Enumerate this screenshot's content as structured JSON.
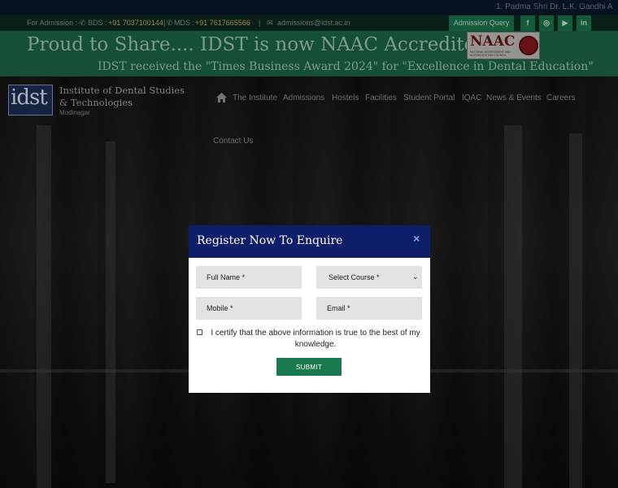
{
  "ticker": {
    "text": "1. Padma Shri Dr. L.K. Gandhi A"
  },
  "topbar": {
    "admission_prefix": "For Admission :-",
    "bds_label": "BDS :",
    "bds_phone": "+91 7037100144",
    "mds_label": "MDS :",
    "mds_phone": "+91 7617665566",
    "email": "admissions@idst.ac.in",
    "admission_query": "Admission Query",
    "social": [
      {
        "icon": "facebook-icon",
        "glyph": "f"
      },
      {
        "icon": "instagram-icon",
        "glyph": "◎"
      },
      {
        "icon": "youtube-icon",
        "glyph": "▶"
      },
      {
        "icon": "linkedin-icon",
        "glyph": "in"
      }
    ]
  },
  "banner": {
    "title": "Proud to Share.... IDST is now NAAC Accredited",
    "subtitle": "IDST received the \"Times Business Award 2024\" for \"Excellence in Dental Education\"",
    "naac_logo_text": "NAAC",
    "naac_logo_sub": "NATIONAL ASSESSMENT AND ACCREDITATION COUNCIL"
  },
  "brand": {
    "logo_text": "idst",
    "name": "Institute of Dental Studies & Technologies",
    "location": "Modinagar"
  },
  "nav": {
    "items": [
      "The Institute",
      "Admissions",
      "Hostels",
      "Facilities",
      "Student Portal",
      "IQAC",
      "News & Events",
      "Careers"
    ],
    "contact": "Contact Us"
  },
  "modal": {
    "title": "Register Now To Enquire",
    "close": "×",
    "full_name_placeholder": "Full Name *",
    "course_selected": "Select Course *",
    "mobile_placeholder": "Mobile *",
    "email_placeholder": "Email *",
    "certify_text": "I certify that the above information is true to the best of my knowledge.",
    "submit": "SUBMIT"
  },
  "colors": {
    "accent_green": "#1a7a4f",
    "modal_header": "#0e1e6a",
    "banner_green": "#1c6b49"
  }
}
